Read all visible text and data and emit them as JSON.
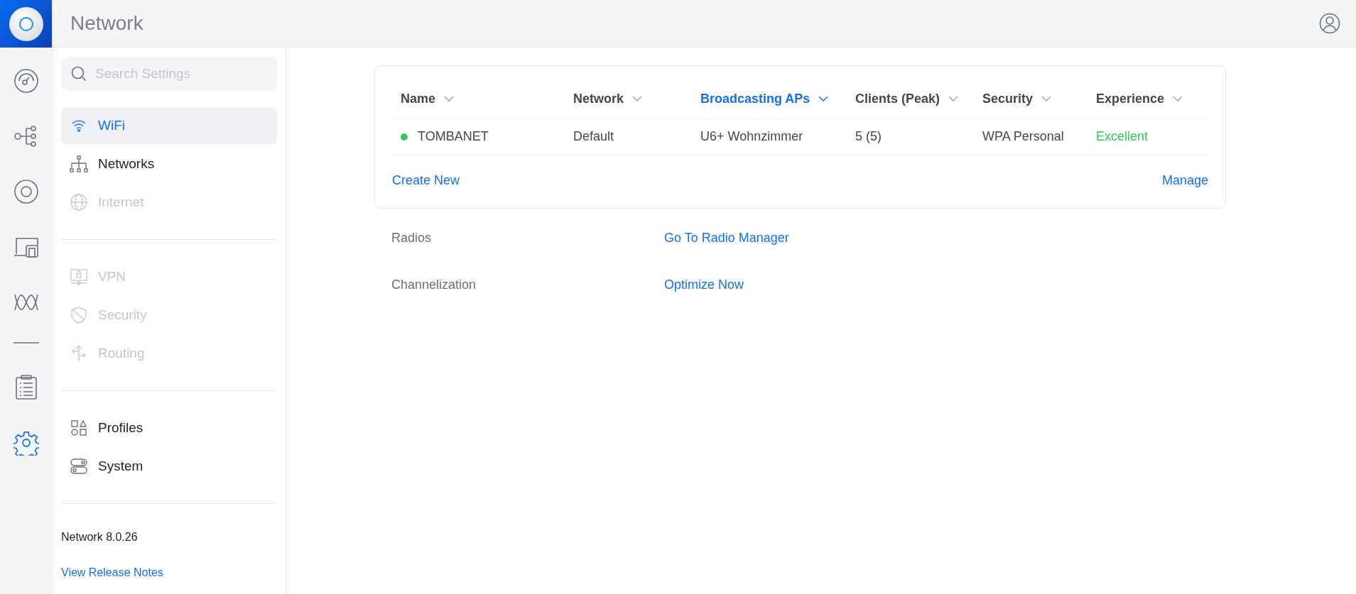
{
  "header": {
    "title": "Network"
  },
  "rail": [
    {
      "selected": false
    },
    {
      "selected": false
    },
    {
      "selected": false
    },
    {
      "selected": false
    },
    {
      "selected": false
    },
    {
      "selected": false
    },
    {
      "selected": true
    }
  ],
  "sidebar": {
    "search": {
      "placeholder": "Search Settings"
    },
    "groups": [
      [
        {
          "label": "WiFi",
          "selected": true,
          "disabled": false
        },
        {
          "label": "Networks",
          "selected": false,
          "disabled": false
        },
        {
          "label": "Internet",
          "selected": false,
          "disabled": true
        }
      ],
      [
        {
          "label": "VPN",
          "selected": false,
          "disabled": true
        },
        {
          "label": "Security",
          "selected": false,
          "disabled": true
        },
        {
          "label": "Routing",
          "selected": false,
          "disabled": true
        }
      ],
      [
        {
          "label": "Profiles",
          "selected": false,
          "disabled": false
        },
        {
          "label": "System",
          "selected": false,
          "disabled": false
        }
      ]
    ],
    "version": "Network 8.0.26",
    "release_notes": "View Release Notes"
  },
  "table": {
    "columns": [
      {
        "label": "Name",
        "sorted": false
      },
      {
        "label": "Network",
        "sorted": false
      },
      {
        "label": "Broadcasting APs",
        "sorted": true
      },
      {
        "label": "Clients (Peak)",
        "sorted": false
      },
      {
        "label": "Security",
        "sorted": false
      },
      {
        "label": "Experience",
        "sorted": false
      }
    ],
    "rows": [
      {
        "color": "#39c55b",
        "cells": [
          "TOMBANET",
          "Default",
          "U6+ Wohnzimmer",
          "5 (5)",
          "WPA Personal",
          "Excellent"
        ]
      }
    ],
    "create": "Create New",
    "manage": "Manage"
  },
  "settings": [
    {
      "label": "Radios",
      "action": "Go To Radio Manager"
    },
    {
      "label": "Channelization",
      "action": "Optimize Now"
    }
  ]
}
